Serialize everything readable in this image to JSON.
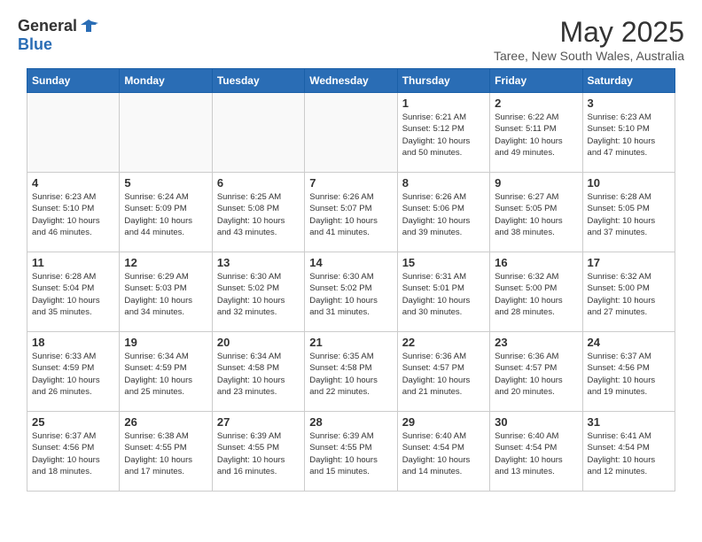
{
  "header": {
    "logo_general": "General",
    "logo_blue": "Blue",
    "month": "May 2025",
    "location": "Taree, New South Wales, Australia"
  },
  "days_of_week": [
    "Sunday",
    "Monday",
    "Tuesday",
    "Wednesday",
    "Thursday",
    "Friday",
    "Saturday"
  ],
  "weeks": [
    [
      {
        "day": "",
        "info": ""
      },
      {
        "day": "",
        "info": ""
      },
      {
        "day": "",
        "info": ""
      },
      {
        "day": "",
        "info": ""
      },
      {
        "day": "1",
        "info": "Sunrise: 6:21 AM\nSunset: 5:12 PM\nDaylight: 10 hours\nand 50 minutes."
      },
      {
        "day": "2",
        "info": "Sunrise: 6:22 AM\nSunset: 5:11 PM\nDaylight: 10 hours\nand 49 minutes."
      },
      {
        "day": "3",
        "info": "Sunrise: 6:23 AM\nSunset: 5:10 PM\nDaylight: 10 hours\nand 47 minutes."
      }
    ],
    [
      {
        "day": "4",
        "info": "Sunrise: 6:23 AM\nSunset: 5:10 PM\nDaylight: 10 hours\nand 46 minutes."
      },
      {
        "day": "5",
        "info": "Sunrise: 6:24 AM\nSunset: 5:09 PM\nDaylight: 10 hours\nand 44 minutes."
      },
      {
        "day": "6",
        "info": "Sunrise: 6:25 AM\nSunset: 5:08 PM\nDaylight: 10 hours\nand 43 minutes."
      },
      {
        "day": "7",
        "info": "Sunrise: 6:26 AM\nSunset: 5:07 PM\nDaylight: 10 hours\nand 41 minutes."
      },
      {
        "day": "8",
        "info": "Sunrise: 6:26 AM\nSunset: 5:06 PM\nDaylight: 10 hours\nand 39 minutes."
      },
      {
        "day": "9",
        "info": "Sunrise: 6:27 AM\nSunset: 5:05 PM\nDaylight: 10 hours\nand 38 minutes."
      },
      {
        "day": "10",
        "info": "Sunrise: 6:28 AM\nSunset: 5:05 PM\nDaylight: 10 hours\nand 37 minutes."
      }
    ],
    [
      {
        "day": "11",
        "info": "Sunrise: 6:28 AM\nSunset: 5:04 PM\nDaylight: 10 hours\nand 35 minutes."
      },
      {
        "day": "12",
        "info": "Sunrise: 6:29 AM\nSunset: 5:03 PM\nDaylight: 10 hours\nand 34 minutes."
      },
      {
        "day": "13",
        "info": "Sunrise: 6:30 AM\nSunset: 5:02 PM\nDaylight: 10 hours\nand 32 minutes."
      },
      {
        "day": "14",
        "info": "Sunrise: 6:30 AM\nSunset: 5:02 PM\nDaylight: 10 hours\nand 31 minutes."
      },
      {
        "day": "15",
        "info": "Sunrise: 6:31 AM\nSunset: 5:01 PM\nDaylight: 10 hours\nand 30 minutes."
      },
      {
        "day": "16",
        "info": "Sunrise: 6:32 AM\nSunset: 5:00 PM\nDaylight: 10 hours\nand 28 minutes."
      },
      {
        "day": "17",
        "info": "Sunrise: 6:32 AM\nSunset: 5:00 PM\nDaylight: 10 hours\nand 27 minutes."
      }
    ],
    [
      {
        "day": "18",
        "info": "Sunrise: 6:33 AM\nSunset: 4:59 PM\nDaylight: 10 hours\nand 26 minutes."
      },
      {
        "day": "19",
        "info": "Sunrise: 6:34 AM\nSunset: 4:59 PM\nDaylight: 10 hours\nand 25 minutes."
      },
      {
        "day": "20",
        "info": "Sunrise: 6:34 AM\nSunset: 4:58 PM\nDaylight: 10 hours\nand 23 minutes."
      },
      {
        "day": "21",
        "info": "Sunrise: 6:35 AM\nSunset: 4:58 PM\nDaylight: 10 hours\nand 22 minutes."
      },
      {
        "day": "22",
        "info": "Sunrise: 6:36 AM\nSunset: 4:57 PM\nDaylight: 10 hours\nand 21 minutes."
      },
      {
        "day": "23",
        "info": "Sunrise: 6:36 AM\nSunset: 4:57 PM\nDaylight: 10 hours\nand 20 minutes."
      },
      {
        "day": "24",
        "info": "Sunrise: 6:37 AM\nSunset: 4:56 PM\nDaylight: 10 hours\nand 19 minutes."
      }
    ],
    [
      {
        "day": "25",
        "info": "Sunrise: 6:37 AM\nSunset: 4:56 PM\nDaylight: 10 hours\nand 18 minutes."
      },
      {
        "day": "26",
        "info": "Sunrise: 6:38 AM\nSunset: 4:55 PM\nDaylight: 10 hours\nand 17 minutes."
      },
      {
        "day": "27",
        "info": "Sunrise: 6:39 AM\nSunset: 4:55 PM\nDaylight: 10 hours\nand 16 minutes."
      },
      {
        "day": "28",
        "info": "Sunrise: 6:39 AM\nSunset: 4:55 PM\nDaylight: 10 hours\nand 15 minutes."
      },
      {
        "day": "29",
        "info": "Sunrise: 6:40 AM\nSunset: 4:54 PM\nDaylight: 10 hours\nand 14 minutes."
      },
      {
        "day": "30",
        "info": "Sunrise: 6:40 AM\nSunset: 4:54 PM\nDaylight: 10 hours\nand 13 minutes."
      },
      {
        "day": "31",
        "info": "Sunrise: 6:41 AM\nSunset: 4:54 PM\nDaylight: 10 hours\nand 12 minutes."
      }
    ]
  ]
}
